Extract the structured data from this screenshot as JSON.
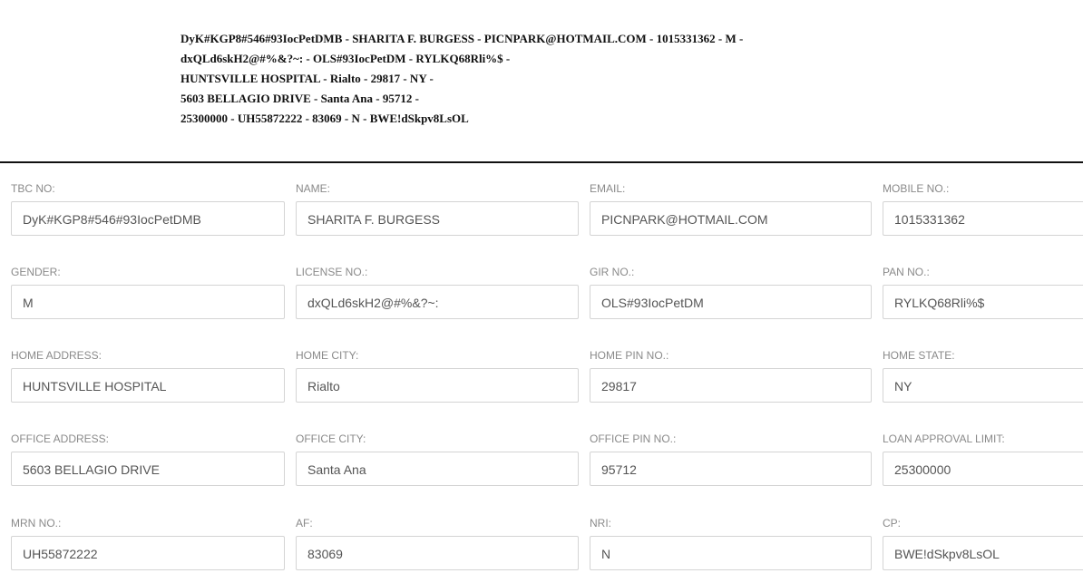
{
  "summary": {
    "lines": [
      "DyK#KGP8#546#93IocPetDMB - SHARITA F. BURGESS - PICNPARK@HOTMAIL.COM - 1015331362 - M -",
      "dxQLd6skH2@#%&?~: - OLS#93IocPetDM - RYLKQ68Rli%$ -",
      "HUNTSVILLE HOSPITAL - Rialto - 29817 - NY -",
      "5603 BELLAGIO DRIVE - Santa Ana - 95712 -",
      "25300000 - UH55872222 - 83069 - N - BWE!dSkpv8LsOL"
    ]
  },
  "form": {
    "fields": [
      {
        "label": "TBC NO:",
        "value": "DyK#KGP8#546#93IocPetDMB"
      },
      {
        "label": "NAME:",
        "value": "SHARITA F. BURGESS"
      },
      {
        "label": "EMAIL:",
        "value": "PICNPARK@HOTMAIL.COM"
      },
      {
        "label": "MOBILE NO.:",
        "value": "1015331362"
      },
      {
        "label": "GENDER:",
        "value": "M"
      },
      {
        "label": "LICENSE NO.:",
        "value": "dxQLd6skH2@#%&?~:"
      },
      {
        "label": "GIR NO.:",
        "value": "OLS#93IocPetDM"
      },
      {
        "label": "PAN NO.:",
        "value": "RYLKQ68Rli%$"
      },
      {
        "label": "HOME ADDRESS:",
        "value": "HUNTSVILLE HOSPITAL"
      },
      {
        "label": "HOME CITY:",
        "value": "Rialto"
      },
      {
        "label": "HOME PIN NO.:",
        "value": "29817"
      },
      {
        "label": "HOME STATE:",
        "value": "NY"
      },
      {
        "label": "OFFICE ADDRESS:",
        "value": "5603 BELLAGIO DRIVE"
      },
      {
        "label": "OFFICE CITY:",
        "value": "Santa Ana"
      },
      {
        "label": "OFFICE PIN NO.:",
        "value": "95712"
      },
      {
        "label": "LOAN APPROVAL LIMIT:",
        "value": "25300000"
      },
      {
        "label": "MRN NO.:",
        "value": "UH55872222"
      },
      {
        "label": "AF:",
        "value": "83069"
      },
      {
        "label": "NRI:",
        "value": "N"
      },
      {
        "label": "CP:",
        "value": "BWE!dSkpv8LsOL"
      }
    ]
  }
}
